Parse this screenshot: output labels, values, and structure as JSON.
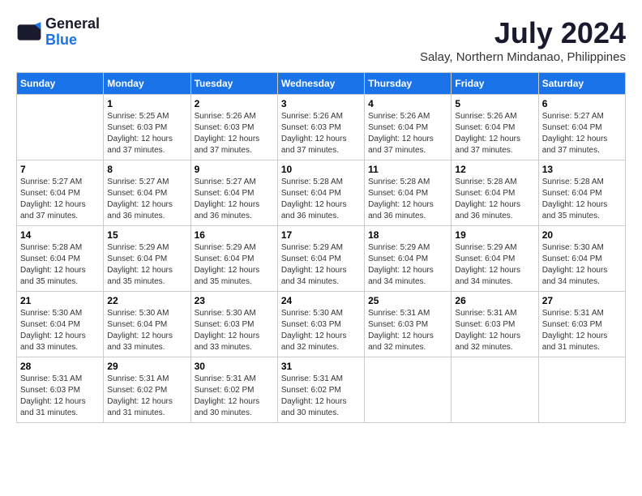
{
  "logo": {
    "line1": "General",
    "line2": "Blue"
  },
  "title": "July 2024",
  "subtitle": "Salay, Northern Mindanao, Philippines",
  "days_of_week": [
    "Sunday",
    "Monday",
    "Tuesday",
    "Wednesday",
    "Thursday",
    "Friday",
    "Saturday"
  ],
  "weeks": [
    [
      {
        "day": "",
        "info": ""
      },
      {
        "day": "1",
        "info": "Sunrise: 5:25 AM\nSunset: 6:03 PM\nDaylight: 12 hours\nand 37 minutes."
      },
      {
        "day": "2",
        "info": "Sunrise: 5:26 AM\nSunset: 6:03 PM\nDaylight: 12 hours\nand 37 minutes."
      },
      {
        "day": "3",
        "info": "Sunrise: 5:26 AM\nSunset: 6:03 PM\nDaylight: 12 hours\nand 37 minutes."
      },
      {
        "day": "4",
        "info": "Sunrise: 5:26 AM\nSunset: 6:04 PM\nDaylight: 12 hours\nand 37 minutes."
      },
      {
        "day": "5",
        "info": "Sunrise: 5:26 AM\nSunset: 6:04 PM\nDaylight: 12 hours\nand 37 minutes."
      },
      {
        "day": "6",
        "info": "Sunrise: 5:27 AM\nSunset: 6:04 PM\nDaylight: 12 hours\nand 37 minutes."
      }
    ],
    [
      {
        "day": "7",
        "info": "Sunrise: 5:27 AM\nSunset: 6:04 PM\nDaylight: 12 hours\nand 37 minutes."
      },
      {
        "day": "8",
        "info": "Sunrise: 5:27 AM\nSunset: 6:04 PM\nDaylight: 12 hours\nand 36 minutes."
      },
      {
        "day": "9",
        "info": "Sunrise: 5:27 AM\nSunset: 6:04 PM\nDaylight: 12 hours\nand 36 minutes."
      },
      {
        "day": "10",
        "info": "Sunrise: 5:28 AM\nSunset: 6:04 PM\nDaylight: 12 hours\nand 36 minutes."
      },
      {
        "day": "11",
        "info": "Sunrise: 5:28 AM\nSunset: 6:04 PM\nDaylight: 12 hours\nand 36 minutes."
      },
      {
        "day": "12",
        "info": "Sunrise: 5:28 AM\nSunset: 6:04 PM\nDaylight: 12 hours\nand 36 minutes."
      },
      {
        "day": "13",
        "info": "Sunrise: 5:28 AM\nSunset: 6:04 PM\nDaylight: 12 hours\nand 35 minutes."
      }
    ],
    [
      {
        "day": "14",
        "info": "Sunrise: 5:28 AM\nSunset: 6:04 PM\nDaylight: 12 hours\nand 35 minutes."
      },
      {
        "day": "15",
        "info": "Sunrise: 5:29 AM\nSunset: 6:04 PM\nDaylight: 12 hours\nand 35 minutes."
      },
      {
        "day": "16",
        "info": "Sunrise: 5:29 AM\nSunset: 6:04 PM\nDaylight: 12 hours\nand 35 minutes."
      },
      {
        "day": "17",
        "info": "Sunrise: 5:29 AM\nSunset: 6:04 PM\nDaylight: 12 hours\nand 34 minutes."
      },
      {
        "day": "18",
        "info": "Sunrise: 5:29 AM\nSunset: 6:04 PM\nDaylight: 12 hours\nand 34 minutes."
      },
      {
        "day": "19",
        "info": "Sunrise: 5:29 AM\nSunset: 6:04 PM\nDaylight: 12 hours\nand 34 minutes."
      },
      {
        "day": "20",
        "info": "Sunrise: 5:30 AM\nSunset: 6:04 PM\nDaylight: 12 hours\nand 34 minutes."
      }
    ],
    [
      {
        "day": "21",
        "info": "Sunrise: 5:30 AM\nSunset: 6:04 PM\nDaylight: 12 hours\nand 33 minutes."
      },
      {
        "day": "22",
        "info": "Sunrise: 5:30 AM\nSunset: 6:04 PM\nDaylight: 12 hours\nand 33 minutes."
      },
      {
        "day": "23",
        "info": "Sunrise: 5:30 AM\nSunset: 6:03 PM\nDaylight: 12 hours\nand 33 minutes."
      },
      {
        "day": "24",
        "info": "Sunrise: 5:30 AM\nSunset: 6:03 PM\nDaylight: 12 hours\nand 32 minutes."
      },
      {
        "day": "25",
        "info": "Sunrise: 5:31 AM\nSunset: 6:03 PM\nDaylight: 12 hours\nand 32 minutes."
      },
      {
        "day": "26",
        "info": "Sunrise: 5:31 AM\nSunset: 6:03 PM\nDaylight: 12 hours\nand 32 minutes."
      },
      {
        "day": "27",
        "info": "Sunrise: 5:31 AM\nSunset: 6:03 PM\nDaylight: 12 hours\nand 31 minutes."
      }
    ],
    [
      {
        "day": "28",
        "info": "Sunrise: 5:31 AM\nSunset: 6:03 PM\nDaylight: 12 hours\nand 31 minutes."
      },
      {
        "day": "29",
        "info": "Sunrise: 5:31 AM\nSunset: 6:02 PM\nDaylight: 12 hours\nand 31 minutes."
      },
      {
        "day": "30",
        "info": "Sunrise: 5:31 AM\nSunset: 6:02 PM\nDaylight: 12 hours\nand 30 minutes."
      },
      {
        "day": "31",
        "info": "Sunrise: 5:31 AM\nSunset: 6:02 PM\nDaylight: 12 hours\nand 30 minutes."
      },
      {
        "day": "",
        "info": ""
      },
      {
        "day": "",
        "info": ""
      },
      {
        "day": "",
        "info": ""
      }
    ]
  ]
}
